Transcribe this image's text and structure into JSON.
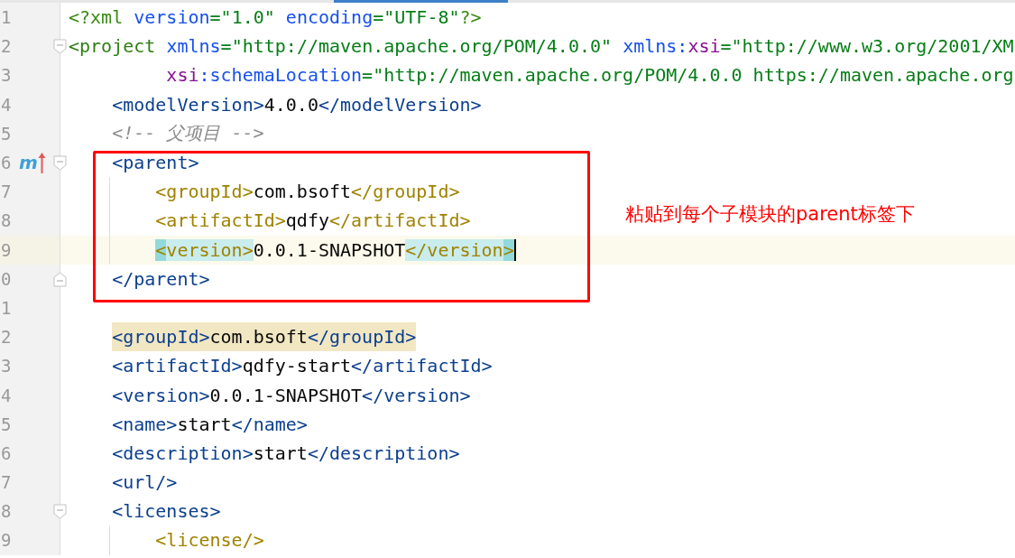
{
  "editor": {
    "lines": [
      {
        "kind": "code",
        "number": "1",
        "tokens": [
          {
            "kind": "pi",
            "text": "<?xml "
          },
          {
            "kind": "attr",
            "text": "version"
          },
          {
            "kind": "value",
            "text": "=\"1.0\" "
          },
          {
            "kind": "attr",
            "text": "encoding"
          },
          {
            "kind": "value",
            "text": "=\"UTF-8\""
          },
          {
            "kind": "pi",
            "text": "?>"
          }
        ]
      },
      {
        "kind": "code",
        "number": "2",
        "fold": {
          "kind": "start"
        },
        "tokens": [
          {
            "kind": "root",
            "text": "<project "
          },
          {
            "kind": "attr",
            "text": "xmlns"
          },
          {
            "kind": "value",
            "text": "=\"http://maven.apache.org/POM/4.0.0\" "
          },
          {
            "kind": "attr",
            "text": "xmlns:"
          },
          {
            "kind": "ns",
            "text": "xsi"
          },
          {
            "kind": "value",
            "text": "=\"http://www.w3.org/2001/XM"
          }
        ],
        "children": [
          {
            "kind": "continuation",
            "number": "3",
            "tokens": [
              {
                "kind": "ns",
                "text": "xsi"
              },
              {
                "kind": "attr",
                "text": ":schemaLocation"
              },
              {
                "kind": "value",
                "text": "=\"http://maven.apache.org/POM/4.0.0 https://maven.apache.org"
              }
            ]
          },
          {
            "kind": "code",
            "number": "4",
            "tokens": [
              {
                "kind": "tag",
                "text": "<modelVersion>"
              },
              {
                "kind": "text",
                "text": "4.0.0"
              },
              {
                "kind": "tag",
                "text": "</modelVersion>"
              }
            ]
          },
          {
            "kind": "code",
            "number": "5",
            "tokens": [
              {
                "kind": "comment",
                "text": "<!-- 父项目 -->"
              }
            ]
          },
          {
            "kind": "code",
            "number": "6",
            "fold": {
              "kind": "start"
            },
            "gutter_mark": "m",
            "tokens": [
              {
                "kind": "tag",
                "text": "<parent>"
              }
            ],
            "children": [
              {
                "kind": "code",
                "number": "7",
                "guide": true,
                "tokens": [
                  {
                    "kind": "tag2",
                    "text": "<groupId>"
                  },
                  {
                    "kind": "text",
                    "text": "com.bsoft"
                  },
                  {
                    "kind": "tag2",
                    "text": "</groupId>"
                  }
                ]
              },
              {
                "kind": "code",
                "number": "8",
                "guide": true,
                "tokens": [
                  {
                    "kind": "tag2",
                    "text": "<artifactId>"
                  },
                  {
                    "kind": "text",
                    "text": "qdfy"
                  },
                  {
                    "kind": "tag2",
                    "text": "</artifactId>"
                  }
                ]
              },
              {
                "kind": "code",
                "number": "9",
                "guide": true,
                "current": true,
                "caret": true,
                "tokens": [
                  {
                    "kind": "tag2",
                    "text": "<version>",
                    "match": {
                      "kind": "start"
                    }
                  },
                  {
                    "kind": "text",
                    "text": "0.0.1-SNAPSHOT"
                  },
                  {
                    "kind": "tag2",
                    "text": "</version>",
                    "match": {
                      "kind": "end"
                    }
                  }
                ]
              }
            ]
          },
          {
            "kind": "code",
            "number": "0",
            "fold": {
              "kind": "end"
            },
            "tokens": [
              {
                "kind": "tag",
                "text": "</parent>"
              }
            ]
          },
          {
            "kind": "code",
            "number": "1"
          },
          {
            "kind": "code",
            "number": "2",
            "highlighted": true,
            "tokens": [
              {
                "kind": "tag",
                "text": "<groupId>"
              },
              {
                "kind": "text",
                "text": "com.bsoft"
              },
              {
                "kind": "tag",
                "text": "</groupId>"
              }
            ]
          },
          {
            "kind": "code",
            "number": "3",
            "tokens": [
              {
                "kind": "tag",
                "text": "<artifactId>"
              },
              {
                "kind": "text",
                "text": "qdfy-start"
              },
              {
                "kind": "tag",
                "text": "</artifactId>"
              }
            ]
          },
          {
            "kind": "code",
            "number": "4",
            "tokens": [
              {
                "kind": "tag",
                "text": "<version>"
              },
              {
                "kind": "text",
                "text": "0.0.1-SNAPSHOT"
              },
              {
                "kind": "tag",
                "text": "</version>"
              }
            ]
          },
          {
            "kind": "code",
            "number": "5",
            "tokens": [
              {
                "kind": "tag",
                "text": "<name>"
              },
              {
                "kind": "text",
                "text": "start"
              },
              {
                "kind": "tag",
                "text": "</name>"
              }
            ]
          },
          {
            "kind": "code",
            "number": "6",
            "tokens": [
              {
                "kind": "tag",
                "text": "<description>"
              },
              {
                "kind": "text",
                "text": "start"
              },
              {
                "kind": "tag",
                "text": "</description>"
              }
            ]
          },
          {
            "kind": "code",
            "number": "7",
            "tokens": [
              {
                "kind": "tag",
                "text": "<url/>"
              }
            ]
          },
          {
            "kind": "code",
            "number": "8",
            "fold": {
              "kind": "start"
            },
            "tokens": [
              {
                "kind": "tag",
                "text": "<licenses>"
              }
            ],
            "children": [
              {
                "kind": "code",
                "number": "9",
                "guide": true,
                "tokens": [
                  {
                    "kind": "tag2",
                    "text": "<license/>"
                  }
                ]
              }
            ]
          }
        ]
      }
    ]
  },
  "annotation": {
    "note": "粘贴到每个子模块的parent标签下"
  }
}
